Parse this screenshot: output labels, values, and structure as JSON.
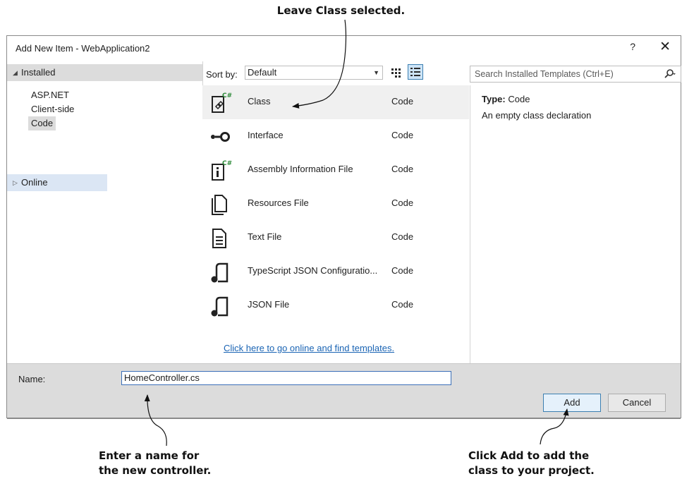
{
  "callouts": {
    "top": "Leave Class selected.",
    "name_line1": "Enter a name for",
    "name_line2": "the new controller.",
    "add_line1": "Click Add to add the",
    "add_line2": "class to your project."
  },
  "dialog": {
    "title": "Add New Item - WebApplication2",
    "help": "?",
    "close": "✕"
  },
  "tree": {
    "installed": "Installed",
    "items": [
      "ASP.NET",
      "Client-side",
      "Code"
    ],
    "selected": "Code",
    "online": "Online"
  },
  "sort": {
    "label": "Sort by:",
    "value": "Default"
  },
  "search": {
    "placeholder": "Search Installed Templates (Ctrl+E)"
  },
  "templates": [
    {
      "name": "Class",
      "category": "Code",
      "icon": "class-icon",
      "selected": true
    },
    {
      "name": "Interface",
      "category": "Code",
      "icon": "interface-icon"
    },
    {
      "name": "Assembly Information File",
      "category": "Code",
      "icon": "assembly-info-icon"
    },
    {
      "name": "Resources File",
      "category": "Code",
      "icon": "resources-file-icon"
    },
    {
      "name": "Text File",
      "category": "Code",
      "icon": "text-file-icon"
    },
    {
      "name": "TypeScript JSON Configuratio...",
      "category": "Code",
      "icon": "json-file-icon"
    },
    {
      "name": "JSON File",
      "category": "Code",
      "icon": "json-file-icon"
    }
  ],
  "online_link": "Click here to go online and find templates.",
  "details": {
    "type_label": "Type:",
    "type_value": "Code",
    "description": "An empty class declaration"
  },
  "bottom": {
    "name_label": "Name:",
    "name_value": "HomeController.cs",
    "add": "Add",
    "cancel": "Cancel"
  },
  "colors": {
    "accent": "#3c7fb1",
    "link": "#1a64b4",
    "selected_row": "#f0f0f0",
    "online_highlight": "#dbe6f4"
  }
}
